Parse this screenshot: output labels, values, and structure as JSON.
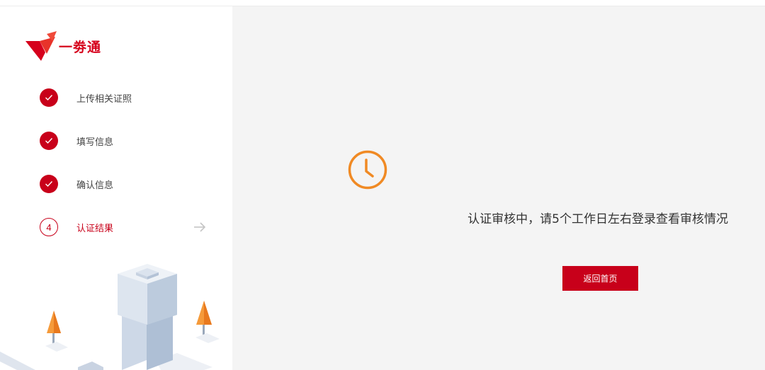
{
  "brand": {
    "name": "一劵通",
    "accent_color": "#c8001a"
  },
  "steps": [
    {
      "number": "1",
      "label": "上传相关证照",
      "status": "done"
    },
    {
      "number": "2",
      "label": "填写信息",
      "status": "done"
    },
    {
      "number": "3",
      "label": "确认信息",
      "status": "done"
    },
    {
      "number": "4",
      "label": "认证结果",
      "status": "current"
    }
  ],
  "status": {
    "icon": "clock-icon",
    "icon_color": "#f08a24",
    "message": "认证审核中，请5个工作日左右登录查看审核情况"
  },
  "actions": {
    "home_button_label": "返回首页"
  }
}
